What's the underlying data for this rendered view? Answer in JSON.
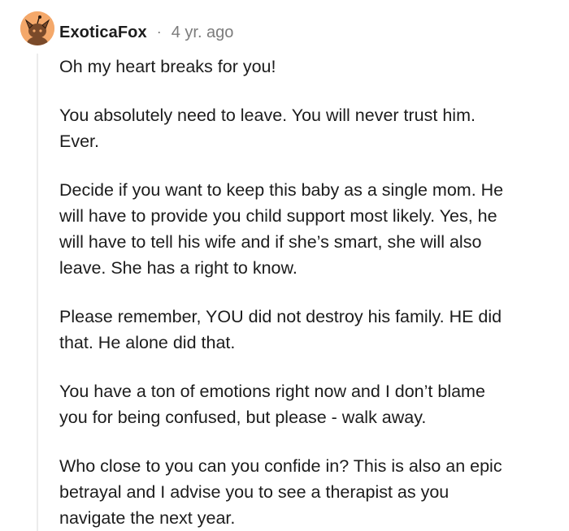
{
  "comment": {
    "author": "ExoticaFox",
    "separator": "·",
    "age": "4 yr. ago",
    "paragraphs": [
      [
        "Oh my heart breaks for you!"
      ],
      [
        "You absolutely need to leave. You will never trust him.",
        "Ever."
      ],
      [
        "Decide if you want to keep this baby as a single mom. He",
        "will have to provide you child support most likely. Yes, he",
        "will have to tell his wife and if she’s smart, she will also",
        "leave. She has a right to know."
      ],
      [
        "Please remember, YOU did not destroy his family. HE did",
        "that. He alone did that."
      ],
      [
        "You have a ton of emotions right now and I don’t blame",
        "you for being confused, but please - walk away."
      ],
      [
        "Who close to you can you confide in? This is also an epic",
        "betrayal and I advise you to see a therapist as you",
        "navigate the next year."
      ]
    ]
  },
  "colors": {
    "avatar_bg": "#f4a86a",
    "text": "#1c1c1c",
    "meta": "#7c7c7c",
    "thread_line": "#ececec"
  },
  "icons": {
    "avatar": "snoo-avatar-icon"
  }
}
